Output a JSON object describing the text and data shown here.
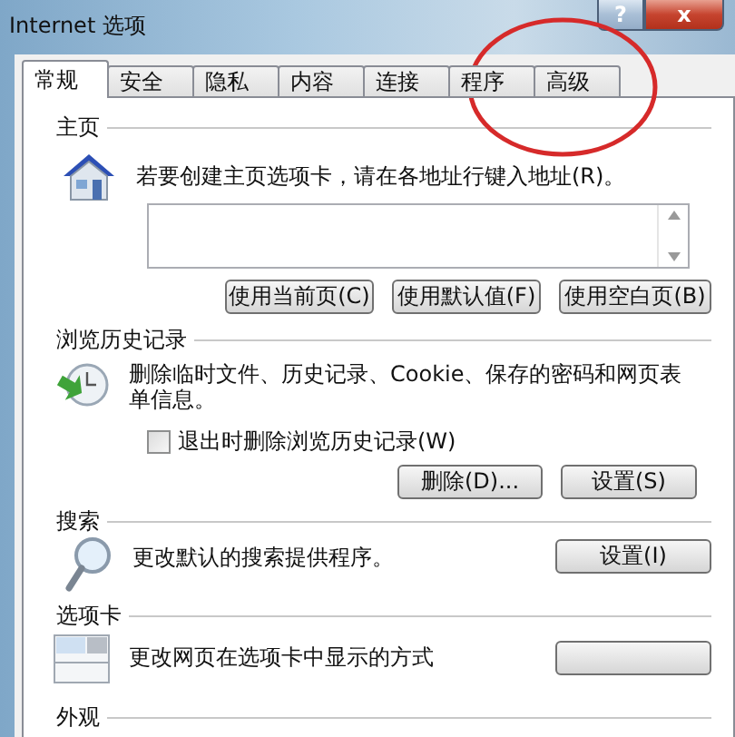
{
  "window": {
    "title": "Internet 选项",
    "title_buttons": [
      "?",
      "x"
    ]
  },
  "tabs": [
    {
      "label": "常规",
      "selected": true
    },
    {
      "label": "安全",
      "selected": false
    },
    {
      "label": "隐私",
      "selected": false
    },
    {
      "label": "内容",
      "selected": false
    },
    {
      "label": "连接",
      "selected": false
    },
    {
      "label": "程序",
      "selected": false
    },
    {
      "label": "高级",
      "selected": false
    }
  ],
  "home_page": {
    "heading": "主页",
    "description": "若要创建主页选项卡，请在各地址行键入地址(R)。",
    "buttons": [
      "使用当前页(C)",
      "使用默认值(F)",
      "使用空白页(B)"
    ]
  },
  "browsing_history": {
    "heading": "浏览历史记录",
    "description": "删除临时文件、历史记录、Cookie、保存的密码和网页表单信息。",
    "checkbox": {
      "label": "退出时删除浏览历史记录(W)",
      "checked": false
    },
    "buttons": [
      "删除(D)...",
      "设置(S)"
    ]
  },
  "search": {
    "heading": "搜索",
    "description": "更改默认的搜索提供程序。",
    "button": "设置(I)"
  },
  "tab_section": {
    "heading": "选项卡",
    "description": "更改网页在选项卡中显示的方式"
  },
  "appearance": {
    "heading": "外观"
  }
}
